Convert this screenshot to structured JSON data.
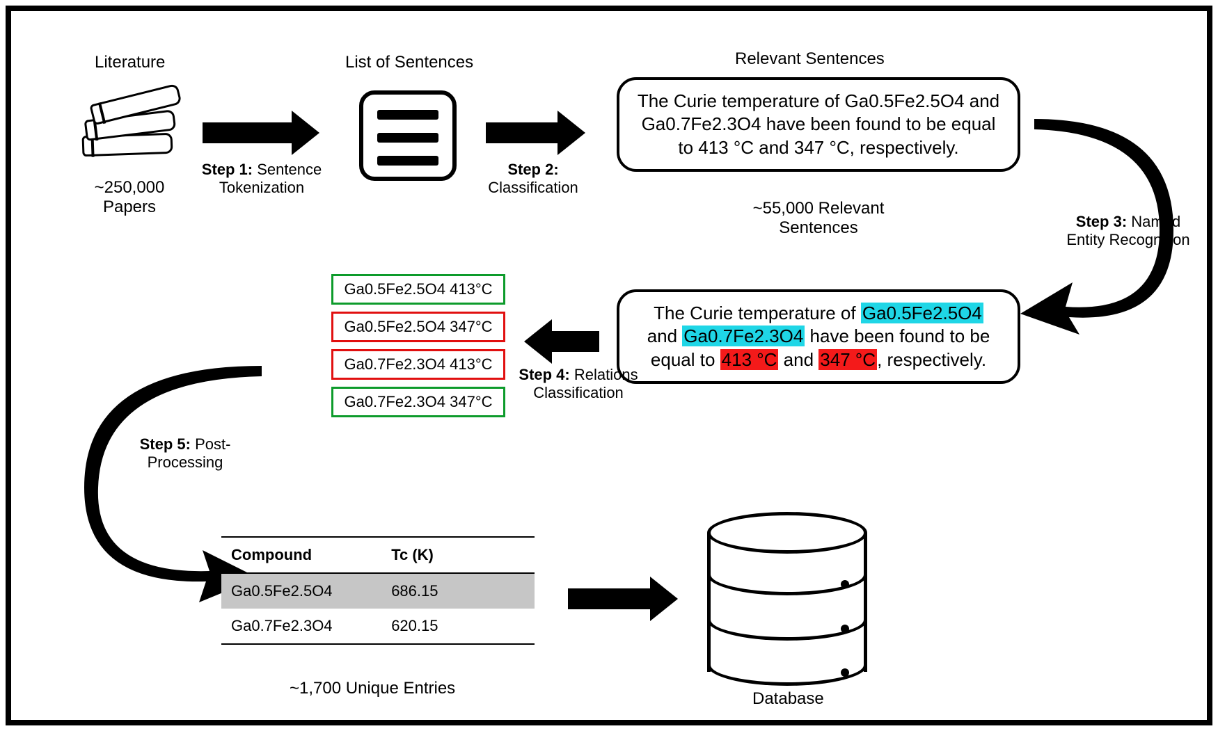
{
  "literature": {
    "title": "Literature",
    "count": "~250,000 Papers"
  },
  "list_of_sentences": {
    "title": "List of Sentences"
  },
  "relevant_sentences": {
    "title": "Relevant Sentences",
    "count": "~55,000 Relevant Sentences",
    "example": "The Curie temperature of Ga0.5Fe2.5O4 and Ga0.7Fe2.3O4 have been found to be equal to 413 °C and 347 °C, respectively."
  },
  "ner_sentence": {
    "prefix": "The Curie temperature of ",
    "comp1": "Ga0.5Fe2.5O4",
    "mid1": " and ",
    "comp2": "Ga0.7Fe2.3O4",
    "mid2": " have been found to be equal to ",
    "val1": "413 °C",
    "mid3": " and ",
    "val2": "347 °C",
    "suffix": ", respectively."
  },
  "pairs": [
    {
      "text": "Ga0.5Fe2.5O4 413°C",
      "valid": true
    },
    {
      "text": "Ga0.5Fe2.5O4 347°C",
      "valid": false
    },
    {
      "text": "Ga0.7Fe2.3O4 413°C",
      "valid": false
    },
    {
      "text": "Ga0.7Fe2.3O4 347°C",
      "valid": true
    }
  ],
  "steps": {
    "s1": {
      "label": "Step 1:",
      "text": "Sentence Tokenization"
    },
    "s2": {
      "label": "Step 2:",
      "text": "Classification"
    },
    "s3": {
      "label": "Step 3:",
      "text": "Named Entity Recognition"
    },
    "s4": {
      "label": "Step 4:",
      "text": "Relations Classification"
    },
    "s5": {
      "label": "Step 5:",
      "text": "Post-Processing"
    }
  },
  "table": {
    "headers": {
      "c1": "Compound",
      "c2": "Tc (K)"
    },
    "rows": [
      {
        "c1": "Ga0.5Fe2.5O4",
        "c2": "686.15"
      },
      {
        "c1": "Ga0.7Fe2.3O4",
        "c2": "620.15"
      }
    ],
    "count": "~1,700 Unique Entries"
  },
  "database": {
    "title": "Database"
  }
}
